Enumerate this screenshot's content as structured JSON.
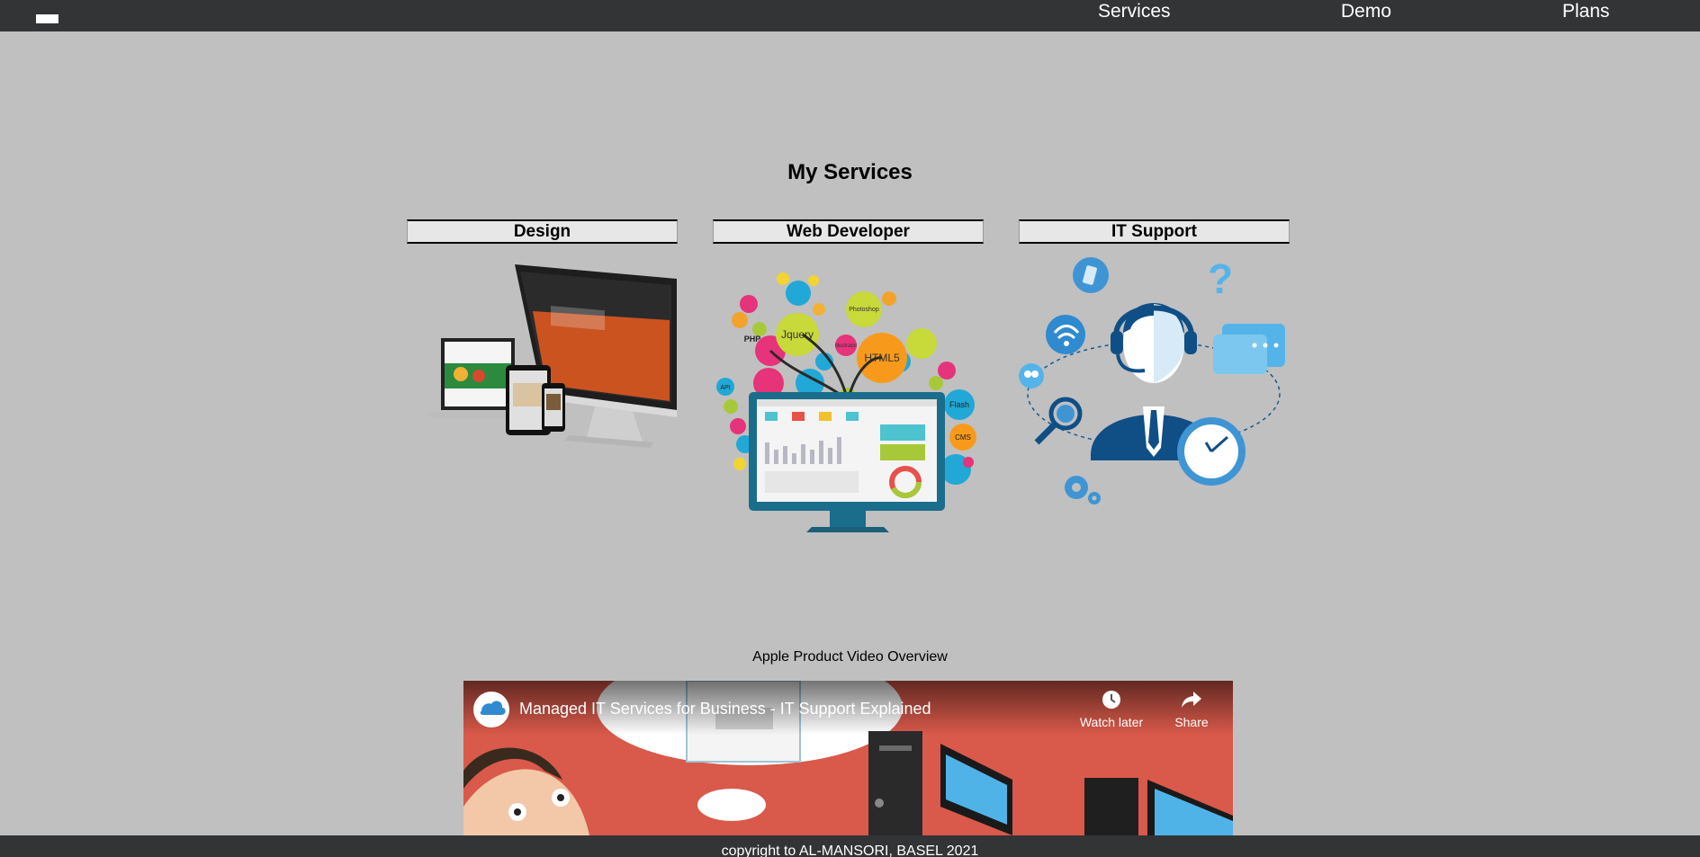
{
  "nav": {
    "links": [
      {
        "label": "Services"
      },
      {
        "label": "Demo"
      },
      {
        "label": "Plans"
      }
    ]
  },
  "services": {
    "title": "My Services",
    "cards": [
      {
        "label": "Design"
      },
      {
        "label": "Web Developer"
      },
      {
        "label": "IT Support"
      }
    ],
    "web_bubbles": [
      "PHP",
      "Jquery",
      "HTML5",
      "Photoshop",
      "Illustrator",
      "API",
      "Flash",
      "CMS"
    ]
  },
  "video": {
    "caption": "Apple Product Video Overview",
    "title": "Managed IT Services for Business - IT Support Explained",
    "watch_later": "Watch later",
    "share": "Share"
  },
  "footer": {
    "copyright": "copyright to AL-MANSORI, BASEL 2021"
  },
  "colors": {
    "nav_bg": "#333436",
    "page_bg": "#c0c0c0",
    "video_bg": "#d9594a"
  }
}
